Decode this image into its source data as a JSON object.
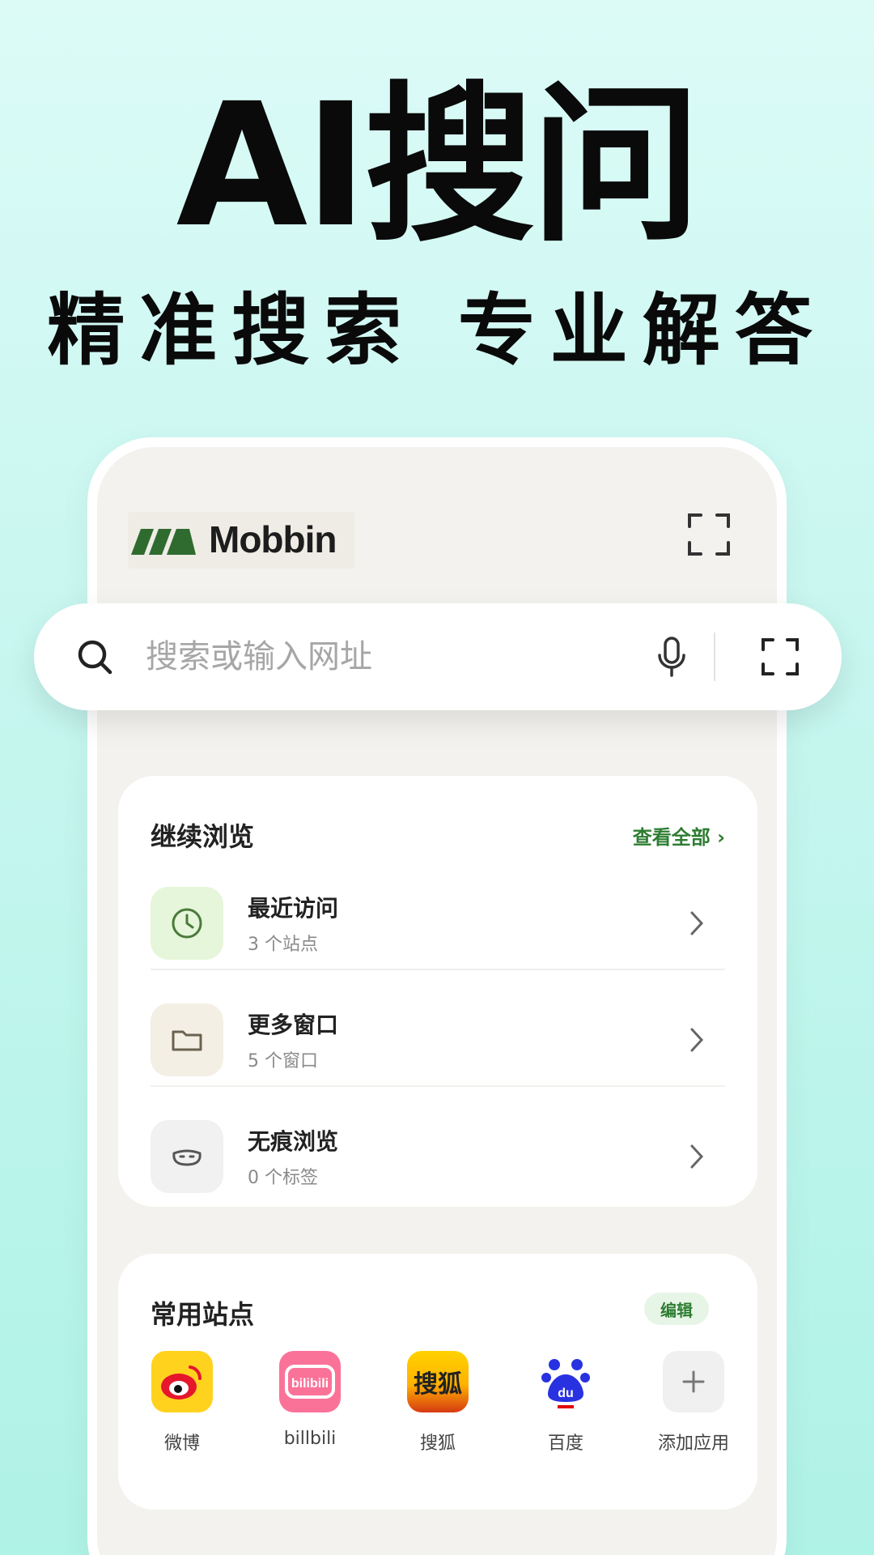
{
  "hero": {
    "title": "AI搜问",
    "subtitle": "精准搜索 专业解答"
  },
  "app": {
    "logo_text": "Mobbin"
  },
  "search": {
    "placeholder": "搜索或输入网址",
    "icons": [
      "search-icon",
      "mic-icon",
      "scan-icon"
    ]
  },
  "continue_browsing": {
    "title": "继续浏览",
    "view_all": "查看全部 ›",
    "items": [
      {
        "title": "最近访问",
        "subtitle": "3 个站点",
        "icon": "clock-icon",
        "bg": "#e6f6da"
      },
      {
        "title": "更多窗口",
        "subtitle": "5 个窗口",
        "icon": "folder-icon",
        "bg": "#f3efe4"
      },
      {
        "title": "无痕浏览",
        "subtitle": "0 个标签",
        "icon": "mask-icon",
        "bg": "#f1f1f1"
      }
    ]
  },
  "frequent_sites": {
    "title": "常用站点",
    "edit": "编辑",
    "sites": [
      {
        "label": "微博",
        "icon": "weibo-icon"
      },
      {
        "label": "billbili",
        "icon": "bilibili-icon",
        "icon_text": "bilibili"
      },
      {
        "label": "搜狐",
        "icon": "sohu-icon",
        "icon_text": "搜狐"
      },
      {
        "label": "百度",
        "icon": "baidu-icon",
        "icon_text": "du"
      },
      {
        "label": "添加应用",
        "icon": "plus-icon"
      }
    ]
  },
  "colors": {
    "accent_green": "#2e7d32",
    "background_top": "#dcfbf7",
    "background_bottom": "#aff2e6"
  }
}
